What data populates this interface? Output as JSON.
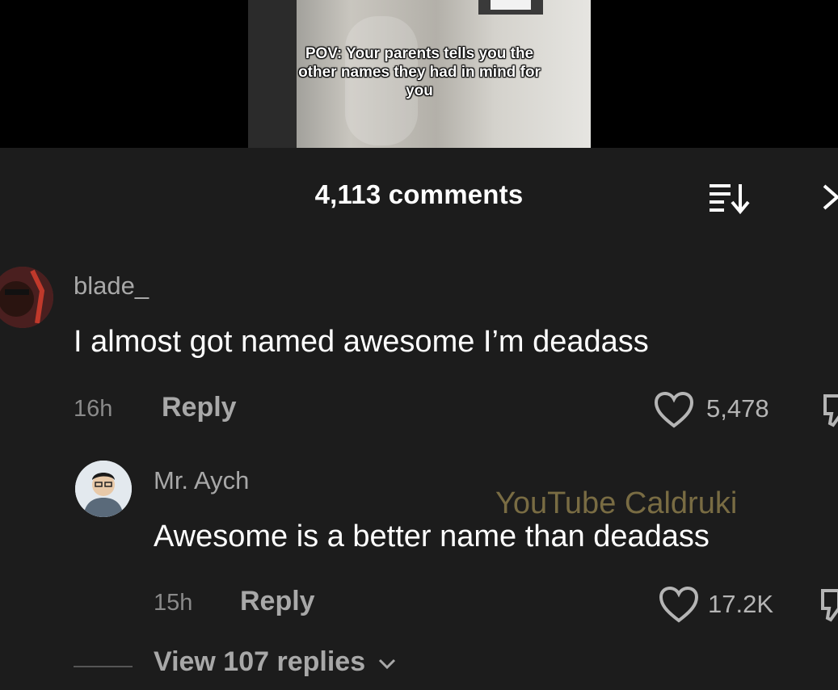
{
  "video": {
    "caption": "POV: Your parents tells you the other names they had in mind for you"
  },
  "header": {
    "comment_count": "4,113 comments",
    "sort_icon": "sort-list-icon",
    "close_icon": "close-chevron-icon"
  },
  "comments": [
    {
      "username": "blade_",
      "text": "I almost got named awesome I’m deadass",
      "time": "16h",
      "reply_label": "Reply",
      "likes": "5,478"
    },
    {
      "username": "Mr. Aych",
      "text": "Awesome is a better name than deadass",
      "time": "15h",
      "reply_label": "Reply",
      "likes": "17.2K"
    }
  ],
  "watermark": "YouTube Caldruki",
  "view_replies": "View 107 replies",
  "colors": {
    "background": "#1c1c1c",
    "text_primary": "#ffffff",
    "text_secondary": "#a8a8a8",
    "watermark": "#8a7a4a"
  }
}
